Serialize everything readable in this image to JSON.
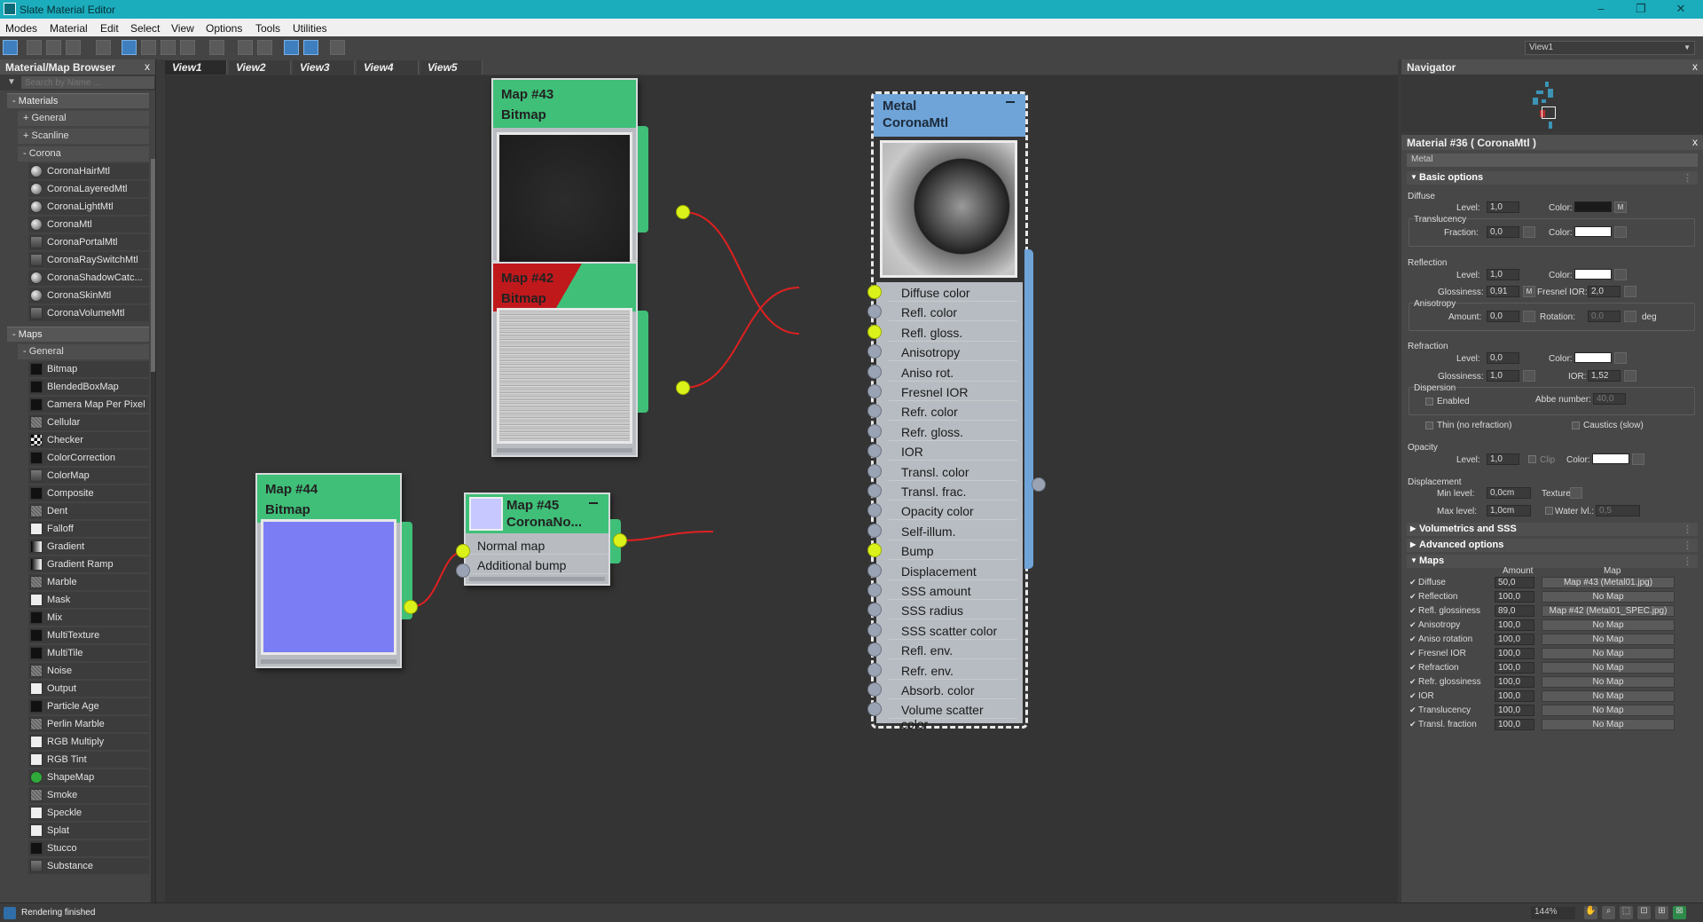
{
  "window": {
    "title": "Slate Material Editor",
    "minimize": "–",
    "restore": "❐",
    "close": "✕"
  },
  "menu": [
    "Modes",
    "Material",
    "Edit",
    "Select",
    "View",
    "Options",
    "Tools",
    "Utilities"
  ],
  "toolbar": {
    "view_select": "View1"
  },
  "browser": {
    "title": "Material/Map Browser",
    "close": "x",
    "search_placeholder": "Search by Name ...",
    "materials_label": "- Materials",
    "general_label": "+ General",
    "scanline_label": "+ Scanline",
    "corona_label": "- Corona",
    "corona_items": [
      "CoronaHairMtl",
      "CoronaLayeredMtl",
      "CoronaLightMtl",
      "CoronaMtl",
      "CoronaPortalMtl",
      "CoronaRaySwitchMtl",
      "CoronaShadowCatc...",
      "CoronaSkinMtl",
      "CoronaVolumeMtl"
    ],
    "maps_label": "- Maps",
    "maps_general_label": "- General",
    "map_items": [
      "Bitmap",
      "BlendedBoxMap",
      "Camera Map Per Pixel",
      "Cellular",
      "Checker",
      "ColorCorrection",
      "ColorMap",
      "Composite",
      "Dent",
      "Falloff",
      "Gradient",
      "Gradient Ramp",
      "Marble",
      "Mask",
      "Mix",
      "MultiTexture",
      "MultiTile",
      "Noise",
      "Output",
      "Particle Age",
      "Perlin Marble",
      "RGB Multiply",
      "RGB Tint",
      "ShapeMap",
      "Smoke",
      "Speckle",
      "Splat",
      "Stucco",
      "Substance"
    ]
  },
  "view_tabs": [
    "View1",
    "View2",
    "View3",
    "View4",
    "View5"
  ],
  "nodes": {
    "map43": {
      "title": "Map #43",
      "type": "Bitmap"
    },
    "map42": {
      "title": "Map #42",
      "type": "Bitmap"
    },
    "map44": {
      "title": "Map #44",
      "type": "Bitmap"
    },
    "map45": {
      "title": "Map #45",
      "type": "CoronaNo...",
      "slots": [
        "Normal map",
        "Additional bump"
      ]
    },
    "metal": {
      "title": "Metal",
      "type": "CoronaMtl",
      "slots": [
        "Diffuse color",
        "Refl. color",
        "Refl. gloss.",
        "Anisotropy",
        "Aniso rot.",
        "Fresnel IOR",
        "Refr. color",
        "Refr. gloss.",
        "IOR",
        "Transl. color",
        "Transl. frac.",
        "Opacity color",
        "Self-illum.",
        "Bump",
        "Displacement",
        "SSS amount",
        "SSS radius",
        "SSS scatter color",
        "Refl. env.",
        "Refr. env.",
        "Absorb. color",
        "Volume scatter color"
      ],
      "connected_slots": [
        0,
        2,
        13
      ]
    }
  },
  "navigator": {
    "title": "Navigator",
    "close": "x"
  },
  "inspector": {
    "title": "Material #36  ( CoronaMtl )",
    "close": "x",
    "name": "Metal",
    "basic_options": "Basic options",
    "diffuse": {
      "label": "Diffuse",
      "level_label": "Level:",
      "level": "1,0",
      "color_label": "Color:",
      "color": "#1a1a1a",
      "m": "M"
    },
    "translucency": {
      "label": "Translucency",
      "fraction_label": "Fraction:",
      "fraction": "0,0",
      "color_label": "Color:",
      "color": "#ffffff"
    },
    "reflection": {
      "label": "Reflection",
      "level_label": "Level:",
      "level": "1,0",
      "color_label": "Color:",
      "color": "#ffffff",
      "gloss_label": "Glossiness:",
      "gloss": "0,91",
      "m": "M",
      "ior_label": "Fresnel IOR:",
      "ior": "2,0"
    },
    "anisotropy": {
      "label": "Anisotropy",
      "amount_label": "Amount:",
      "amount": "0,0",
      "rotation_label": "Rotation:",
      "rotation": "0,0",
      "deg": "deg"
    },
    "refraction": {
      "label": "Refraction",
      "level_label": "Level:",
      "level": "0,0",
      "color_label": "Color:",
      "color": "#ffffff",
      "gloss_label": "Glossiness:",
      "gloss": "1,0",
      "ior_label": "IOR:",
      "ior": "1,52"
    },
    "dispersion": {
      "label": "Dispersion",
      "enabled": "Enabled",
      "abbe_label": "Abbe number:",
      "abbe": "40,0"
    },
    "thin": "Thin (no refraction)",
    "caustics": "Caustics (slow)",
    "opacity": {
      "label": "Opacity",
      "level_label": "Level:",
      "level": "1,0",
      "clip": "Clip",
      "color_label": "Color:",
      "color": "#ffffff"
    },
    "displacement": {
      "label": "Displacement",
      "min_label": "Min level:",
      "min": "0,0cm",
      "texture_label": "Texture:",
      "max_label": "Max level:",
      "max": "1,0cm",
      "water_label": "Water lvl.:",
      "water": "0,5"
    },
    "volumetrics": "Volumetrics and SSS",
    "advanced": "Advanced options",
    "maps": "Maps",
    "maps_amount_header": "Amount",
    "maps_map_header": "Map",
    "map_rows": [
      {
        "name": "Diffuse",
        "amount": "50,0",
        "map": "Map #43 (Metal01.jpg)"
      },
      {
        "name": "Reflection",
        "amount": "100,0",
        "map": "No Map"
      },
      {
        "name": "Refl. glossiness",
        "amount": "89,0",
        "map": "Map #42 (Metal01_SPEC.jpg)"
      },
      {
        "name": "Anisotropy",
        "amount": "100,0",
        "map": "No Map"
      },
      {
        "name": "Aniso rotation",
        "amount": "100,0",
        "map": "No Map"
      },
      {
        "name": "Fresnel IOR",
        "amount": "100,0",
        "map": "No Map"
      },
      {
        "name": "Refraction",
        "amount": "100,0",
        "map": "No Map"
      },
      {
        "name": "Refr. glossiness",
        "amount": "100,0",
        "map": "No Map"
      },
      {
        "name": "IOR",
        "amount": "100,0",
        "map": "No Map"
      },
      {
        "name": "Translucency",
        "amount": "100,0",
        "map": "No Map"
      },
      {
        "name": "Transl. fraction",
        "amount": "100,0",
        "map": "No Map"
      }
    ]
  },
  "status": {
    "text": "Rendering finished",
    "zoom": "144%"
  },
  "colors": {
    "accent": "#1cadbd",
    "bitmap_node": "#3fbf78",
    "material_node": "#6fa4d8",
    "wire": "#e02020",
    "socket_on": "#dbf21a"
  }
}
